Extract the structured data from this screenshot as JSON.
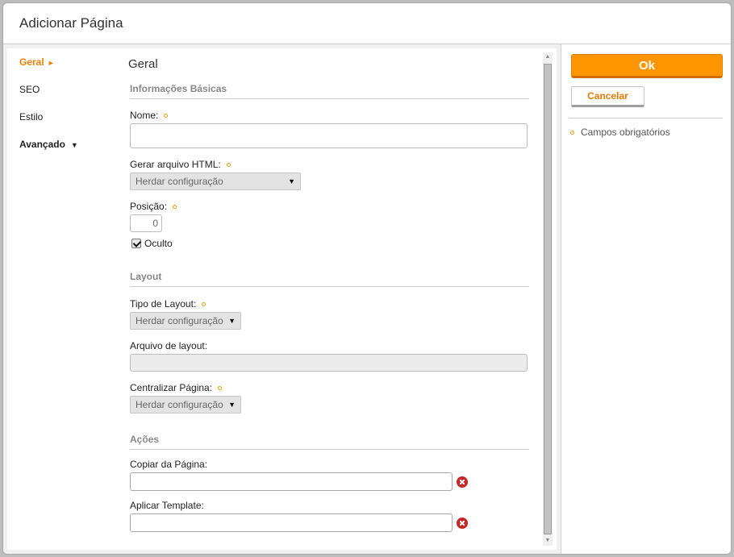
{
  "dialog": {
    "title": "Adicionar Página"
  },
  "nav": {
    "items": [
      {
        "label": "Geral",
        "arrow": "►"
      },
      {
        "label": "SEO"
      },
      {
        "label": "Estilo"
      },
      {
        "label": "Avançado",
        "arrow": "▼"
      }
    ]
  },
  "form": {
    "section_title": "Geral",
    "basic": {
      "title": "Informações Básicas",
      "name_label": "Nome:",
      "name_value": "",
      "html_label": "Gerar arquivo HTML:",
      "html_value": "Herdar configuração",
      "position_label": "Posição:",
      "position_value": "0",
      "hidden_label": "Oculto",
      "hidden_checked": true
    },
    "layout": {
      "title": "Layout",
      "type_label": "Tipo de Layout:",
      "type_value": "Herdar configuração",
      "file_label": "Arquivo de layout:",
      "file_value": "",
      "center_label": "Centralizar Página:",
      "center_value": "Herdar configuração"
    },
    "actions": {
      "title": "Ações",
      "copy_label": "Copiar da Página:",
      "copy_value": "",
      "template_label": "Aplicar Template:",
      "template_value": ""
    }
  },
  "buttons": {
    "ok": "Ok",
    "cancel": "Cancelar"
  },
  "legend": {
    "required": "Campos obrigatórios"
  },
  "icons": {
    "required": "required-marker-icon",
    "clear": "clear-circle-icon",
    "scroll_up": "▲",
    "scroll_down": "▼",
    "select_caret": "▼"
  },
  "colors": {
    "accent": "#ff9500",
    "active_nav": "#f08000",
    "clear": "#c62828"
  }
}
